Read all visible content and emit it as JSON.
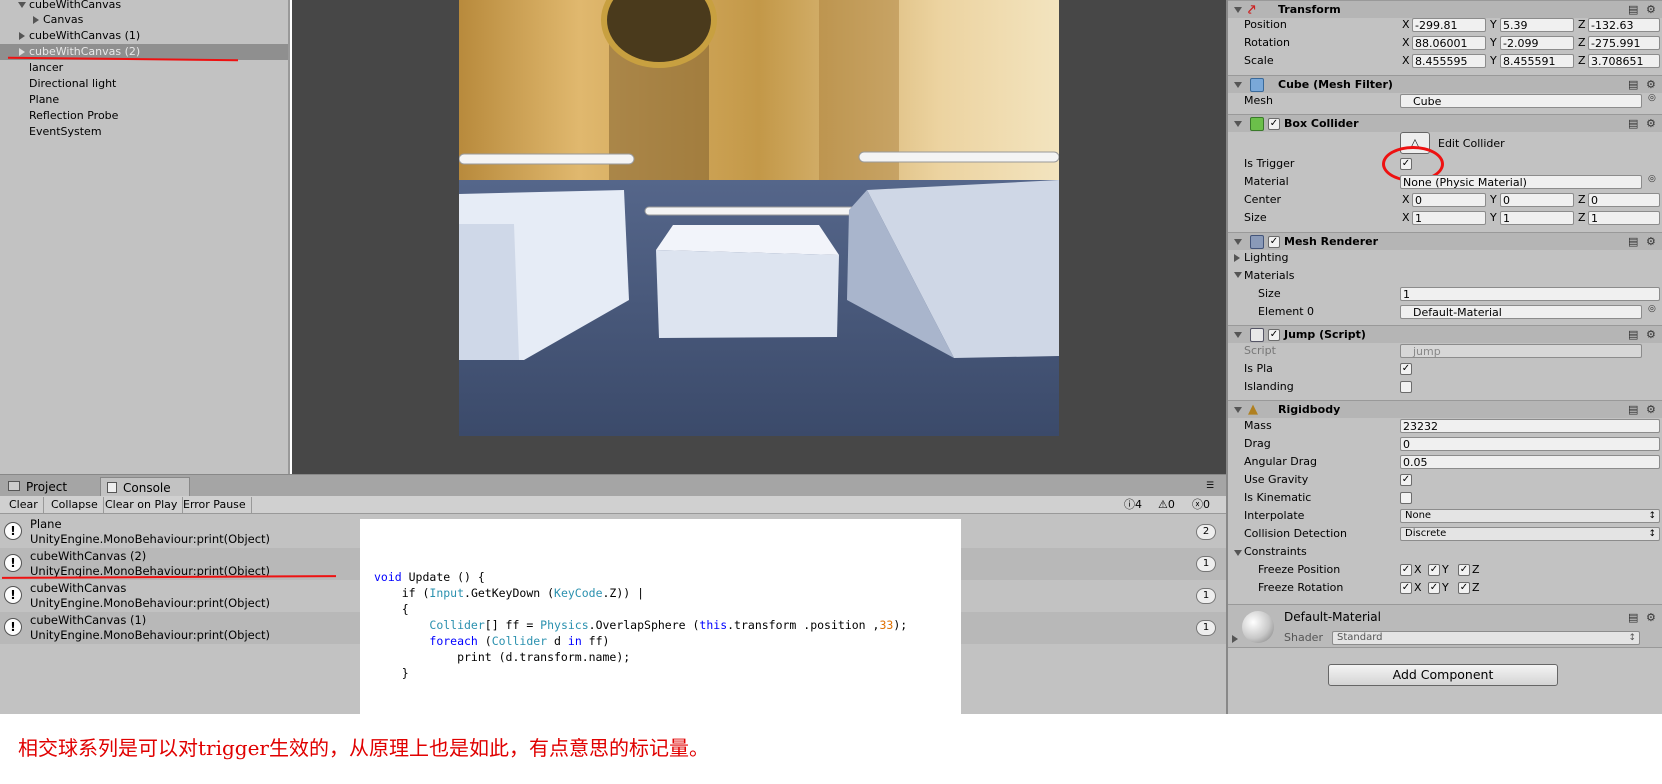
{
  "hierarchy": {
    "items": [
      {
        "label": "cubeWithCanvas",
        "indent": 0,
        "arrow": "down"
      },
      {
        "label": "Canvas",
        "indent": 1,
        "arrow": "right"
      },
      {
        "label": "cubeWithCanvas (1)",
        "indent": 0,
        "arrow": "right"
      },
      {
        "label": "cubeWithCanvas (2)",
        "indent": 0,
        "arrow": "right",
        "selected": true
      },
      {
        "label": "lancer",
        "indent": 0,
        "arrow": ""
      },
      {
        "label": "Directional light",
        "indent": 0,
        "arrow": ""
      },
      {
        "label": "Plane",
        "indent": 0,
        "arrow": ""
      },
      {
        "label": "Reflection Probe",
        "indent": 0,
        "arrow": ""
      },
      {
        "label": "EventSystem",
        "indent": 0,
        "arrow": ""
      }
    ]
  },
  "bottom_tabs": {
    "project": "Project",
    "console": "Console"
  },
  "console_toolbar": {
    "clear": "Clear",
    "collapse": "Collapse",
    "clear_on_play": "Clear on Play",
    "error_pause": "Error Pause",
    "log_count": "4",
    "warn_count": "0",
    "error_count": "0"
  },
  "console_logs": [
    {
      "line1": "Plane",
      "line2": "UnityEngine.MonoBehaviour:print(Object)",
      "count": "2"
    },
    {
      "line1": "cubeWithCanvas (2)",
      "line2": "UnityEngine.MonoBehaviour:print(Object)",
      "count": "1"
    },
    {
      "line1": "cubeWithCanvas",
      "line2": "UnityEngine.MonoBehaviour:print(Object)",
      "count": "1"
    },
    {
      "line1": "cubeWithCanvas (1)",
      "line2": "UnityEngine.MonoBehaviour:print(Object)",
      "count": "1"
    }
  ],
  "code": {
    "l1a": "void",
    "l1b": " Update () {",
    "l2a": "    if (",
    "l2b": "Input",
    "l2c": ".GetKeyDown (",
    "l2d": "KeyCode",
    "l2e": ".Z)) |",
    "l3": "    {",
    "l4a": "        ",
    "l4b": "Collider",
    "l4c": "[] ff = ",
    "l4d": "Physics",
    "l4e": ".OverlapSphere (",
    "l4f": "this",
    "l4g": ".transform .position ,",
    "l4h": "33",
    "l4i": ");",
    "l5a": "        ",
    "l5b": "foreach",
    "l5c": " (",
    "l5d": "Collider",
    "l5e": " d ",
    "l5f": "in",
    "l5g": " ff)",
    "l6": "            print (d.transform.name);",
    "l7": "    }"
  },
  "inspector": {
    "transform": {
      "title": "Transform",
      "position": {
        "label": "Position",
        "x": "-299.81",
        "y": "5.39",
        "z": "-132.63"
      },
      "rotation": {
        "label": "Rotation",
        "x": "88.06001",
        "y": "-2.099",
        "z": "-275.991"
      },
      "scale": {
        "label": "Scale",
        "x": "8.455595",
        "y": "8.455591",
        "z": "3.708651"
      }
    },
    "mesh_filter": {
      "title": "Cube (Mesh Filter)",
      "mesh_label": "Mesh",
      "mesh_value": "Cube"
    },
    "box_collider": {
      "title": "Box Collider",
      "edit_collider": "Edit Collider",
      "is_trigger": "Is Trigger",
      "material": "Material",
      "material_value": "None (Physic Material)",
      "center": {
        "label": "Center",
        "x": "0",
        "y": "0",
        "z": "0"
      },
      "size": {
        "label": "Size",
        "x": "1",
        "y": "1",
        "z": "1"
      }
    },
    "mesh_renderer": {
      "title": "Mesh Renderer",
      "lighting": "Lighting",
      "materials": "Materials",
      "size_label": "Size",
      "size_value": "1",
      "element0_label": "Element 0",
      "element0_value": "Default-Material"
    },
    "jump_script": {
      "title": "Jump (Script)",
      "script_label": "Script",
      "script_value": "jump",
      "is_pla": "Is Pla",
      "islanding": "Islanding"
    },
    "rigidbody": {
      "title": "Rigidbody",
      "mass": "Mass",
      "mass_value": "23232",
      "drag": "Drag",
      "drag_value": "0",
      "angular_drag": "Angular Drag",
      "angular_drag_value": "0.05",
      "use_gravity": "Use Gravity",
      "is_kinematic": "Is Kinematic",
      "interpolate": "Interpolate",
      "interpolate_value": "None",
      "collision_detection": "Collision Detection",
      "collision_detection_value": "Discrete",
      "constraints": "Constraints",
      "freeze_position": "Freeze Position",
      "freeze_rotation": "Freeze Rotation",
      "x": "X",
      "y": "Y",
      "z": "Z"
    },
    "material": {
      "name": "Default-Material",
      "shader_label": "Shader",
      "shader_value": "Standard"
    },
    "add_component": "Add Component"
  },
  "annotation_text": "相交球系列是可以对trigger生效的，从原理上也是如此，有点意思的标记量。",
  "axis_labels": {
    "x": "X",
    "y": "Y",
    "z": "Z"
  },
  "colors": {
    "annotation": "#e00000",
    "code_keyword": "#0000ff",
    "code_type": "#2b91af",
    "code_number": "#e07000"
  }
}
